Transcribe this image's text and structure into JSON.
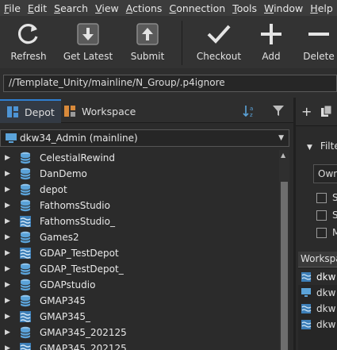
{
  "menubar": {
    "items": [
      {
        "mnemonic": "F",
        "rest": "ile"
      },
      {
        "mnemonic": "E",
        "rest": "dit"
      },
      {
        "mnemonic": "S",
        "rest": "earch",
        "pre": ""
      },
      {
        "mnemonic": "V",
        "rest": "iew"
      },
      {
        "mnemonic": "A",
        "rest": "ctions"
      },
      {
        "mnemonic": "C",
        "rest": "onnection"
      },
      {
        "mnemonic": "T",
        "rest": "ools"
      },
      {
        "mnemonic": "W",
        "rest": "indow"
      },
      {
        "mnemonic": "H",
        "rest": "elp"
      }
    ]
  },
  "toolbar": {
    "refresh": "Refresh",
    "get_latest": "Get Latest",
    "submit": "Submit",
    "checkout": "Checkout",
    "add": "Add",
    "delete": "Delete"
  },
  "path": {
    "value": "//Template_Unity/mainline/N_Group/.p4ignore"
  },
  "left_panel": {
    "tabs": {
      "depot": "Depot",
      "workspace": "Workspace"
    },
    "workspace_selector": "dkw34_Admin (mainline)",
    "tree": [
      {
        "name": "CelestialRewind",
        "icon": "depot-db-icon"
      },
      {
        "name": "DanDemo",
        "icon": "depot-db-icon"
      },
      {
        "name": "depot",
        "icon": "depot-db-icon"
      },
      {
        "name": "FathomsStudio",
        "icon": "depot-db-icon"
      },
      {
        "name": "FathomsStudio_",
        "icon": "stream-depot-icon"
      },
      {
        "name": "Games2",
        "icon": "depot-db-icon"
      },
      {
        "name": "GDAP_TestDepot",
        "icon": "stream-depot-icon"
      },
      {
        "name": "GDAP_TestDepot_",
        "icon": "depot-db-icon"
      },
      {
        "name": "GDAPstudio",
        "icon": "depot-db-icon"
      },
      {
        "name": "GMAP345",
        "icon": "depot-db-icon"
      },
      {
        "name": "GMAP345_",
        "icon": "stream-depot-icon"
      },
      {
        "name": "GMAP345_202125",
        "icon": "depot-db-icon"
      },
      {
        "name": "GMAP345_202125",
        "icon": "stream-depot-icon"
      }
    ]
  },
  "right_panel": {
    "filter_label": "Filte",
    "owner_field": "Owne",
    "checkboxes": [
      "S",
      "S",
      "M"
    ],
    "grid_header": "Workspa",
    "grid_rows": [
      "dkw",
      "dkw",
      "dkw",
      "dkw"
    ]
  },
  "colors": {
    "accent": "#2f7fd0",
    "icon_blue": "#5ba3d9",
    "background": "#2b2b2b"
  }
}
